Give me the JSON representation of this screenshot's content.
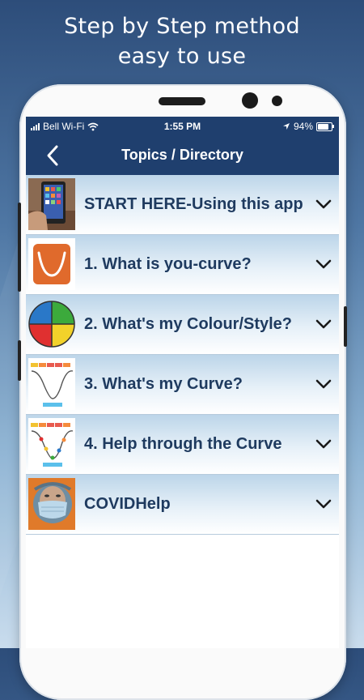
{
  "headline": {
    "line1": "Step by Step method",
    "line2": "easy to use"
  },
  "status_bar": {
    "carrier": "Bell Wi-Fi",
    "time": "1:55 PM",
    "battery": "94%",
    "battery_level": 0.94
  },
  "nav": {
    "title": "Topics / Directory",
    "back_icon": "chevron-left-icon"
  },
  "topics": [
    {
      "label": "START HERE-Using this app",
      "thumbnail": "hand-holding-phone-photo"
    },
    {
      "label": "1. What is you-curve?",
      "thumbnail": "orange-u-curve-logo"
    },
    {
      "label": "2. What's my Colour/Style?",
      "thumbnail": "four-color-quadrant-circle"
    },
    {
      "label": "3. What's my Curve?",
      "thumbnail": "curve-chart-diagram"
    },
    {
      "label": "4. Help through the Curve",
      "thumbnail": "curve-chart-with-dots"
    },
    {
      "label": "COVIDHelp",
      "thumbnail": "person-wearing-mask-photo"
    }
  ],
  "colors": {
    "nav_background": "#1f3f6e",
    "row_text": "#1e3a5f",
    "row_gradient_top": "#bcd5e9",
    "orange": "#e06a2c"
  }
}
